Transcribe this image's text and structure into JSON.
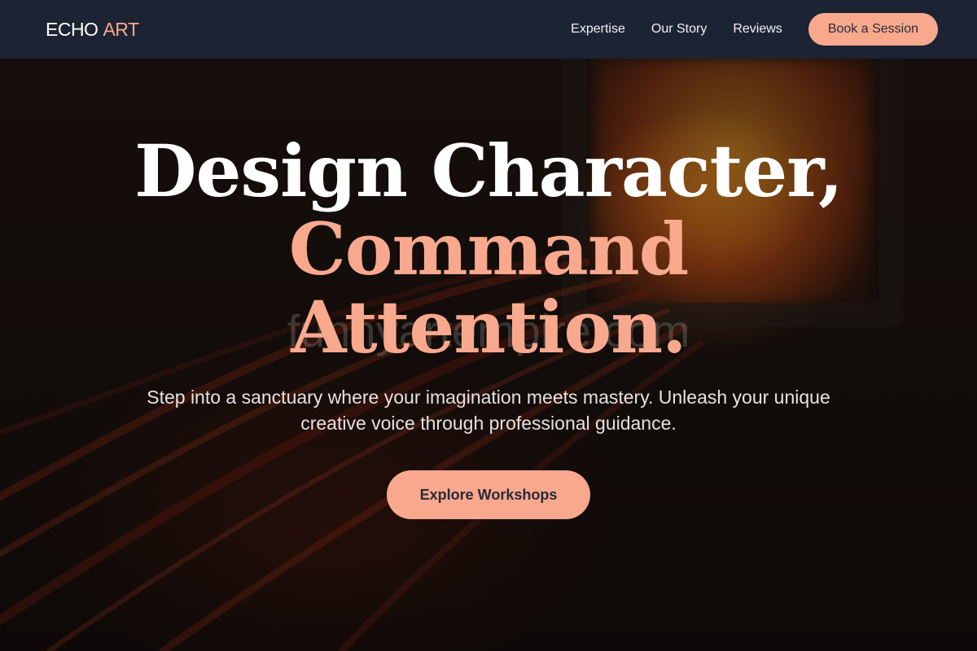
{
  "brand": {
    "name_primary": "ECHO",
    "name_accent": "ART"
  },
  "nav": {
    "links": [
      "Expertise",
      "Our Story",
      "Reviews"
    ],
    "cta_label": "Book a Session"
  },
  "hero": {
    "headline_line1": "Design Character,",
    "headline_line2": "Command",
    "headline_line3": "Attention.",
    "watermark": "funnyartempire.com",
    "subtitle": "Step into a sanctuary where your imagination meets mastery. Unleash your unique creative voice through professional guidance.",
    "cta_label": "Explore Workshops"
  },
  "colors": {
    "accent": "#f8a98d",
    "navbar_bg": "#1c2433",
    "button_text": "#2a2a3a"
  }
}
